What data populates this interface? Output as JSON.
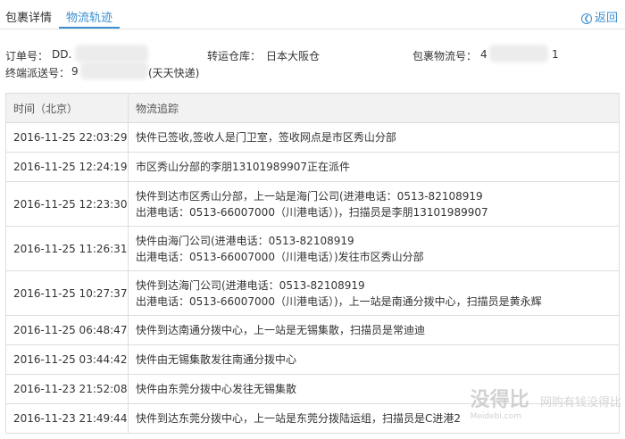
{
  "tabs": [
    "包裹详情",
    "物流轨迹"
  ],
  "back_label": "返回",
  "info": {
    "order_label": "订单号：",
    "order_value": "DD.",
    "warehouse_label": "转运仓库：",
    "warehouse_value": "日本大阪仓",
    "package_label": "包裹物流号：",
    "package_value": "4",
    "package_tail": "1",
    "terminal_label": "终端派送号：",
    "terminal_value": "9",
    "terminal_carrier": "(天天快递)"
  },
  "table": {
    "headers": [
      "时间（北京）",
      "物流追踪"
    ],
    "rows": [
      {
        "time": "2016-11-25 22:03:29",
        "desc": [
          "快件已签收,签收人是门卫室，签收网点是市区秀山分部"
        ]
      },
      {
        "time": "2016-11-25 12:24:19",
        "desc": [
          "市区秀山分部的李朋13101989907正在派件"
        ]
      },
      {
        "time": "2016-11-25 12:23:30",
        "desc": [
          "快件到达市区秀山分部，上一站是海门公司(进港电话：0513-82108919",
          "出港电话：0513-66007000（川港电话）)，扫描员是李朋13101989907"
        ]
      },
      {
        "time": "2016-11-25 11:26:31",
        "desc": [
          "快件由海门公司(进港电话：0513-82108919",
          "出港电话：0513-66007000（川港电话）)发往市区秀山分部"
        ]
      },
      {
        "time": "2016-11-25 10:27:37",
        "desc": [
          "快件到达海门公司(进港电话：0513-82108919",
          "出港电话：0513-66007000（川港电话）)，上一站是南通分拨中心，扫描员是黄永辉"
        ]
      },
      {
        "time": "2016-11-25 06:48:47",
        "desc": [
          "快件到达南通分拨中心，上一站是无锡集散，扫描员是常迪迪"
        ]
      },
      {
        "time": "2016-11-25 03:44:42",
        "desc": [
          "快件由无锡集散发往南通分拨中心"
        ]
      },
      {
        "time": "2016-11-23 21:52:08",
        "desc": [
          "快件由东莞分拨中心发往无锡集散"
        ]
      },
      {
        "time": "2016-11-23 21:49:44",
        "desc": [
          "快件到达东莞分拨中心，上一站是东莞分拨陆运组，扫描员是C进港2"
        ]
      }
    ]
  },
  "watermark": {
    "main": "没得比",
    "sub": "Meidebi.com",
    "slogan": "网购有钱没得比"
  }
}
